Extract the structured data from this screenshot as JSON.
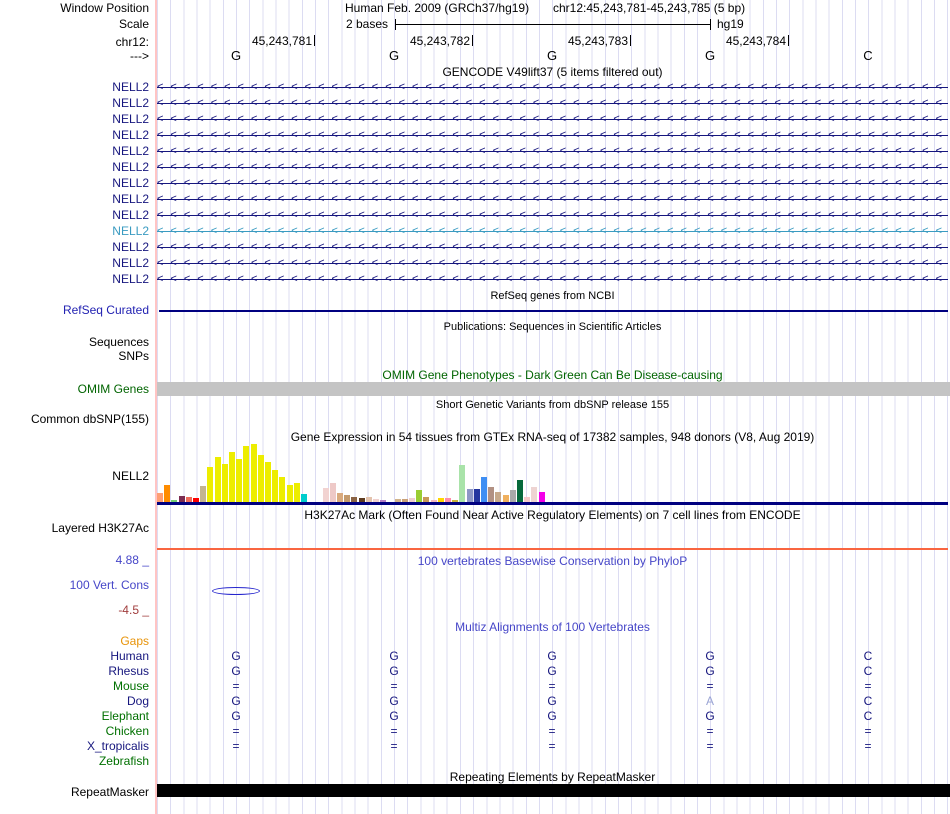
{
  "colors": {
    "navy": "#16167e",
    "teal_highlight": "#3a9bc1",
    "refseq_blue": "#2222b2",
    "omim_green": "#006400",
    "conservation_blue": "#4646c8",
    "conservation_min_red": "#a03c3c",
    "gaps_orange": "#e8940a",
    "species_green": "#007000",
    "muted_base": "#9aa4d4",
    "h3k27ac_line": "#f96540",
    "gtex_baseline": "#000080",
    "omim_bar_gray": "#c4c4c4",
    "repeat_black": "#000000",
    "stripe_lavender": "#dcdcf2",
    "guide_pink": "#ffc4c4"
  },
  "header": {
    "window_position_label": "Window Position",
    "assembly": "Human Feb. 2009 (GRCh37/hg19)",
    "position": "chr12:45,243,781-45,243,785 (5 bp)",
    "scale_label": "Scale",
    "scale_value": "2 bases",
    "genome": "hg19",
    "chrom_label": "chr12:",
    "coords": [
      "45,243,781",
      "45,243,782",
      "45,243,783",
      "45,243,784"
    ],
    "strand_label": "--->",
    "bases": [
      "G",
      "G",
      "G",
      "G",
      "C"
    ]
  },
  "gencode": {
    "title": "GENCODE V49lift37 (5 items filtered out)",
    "genes": [
      {
        "name": "NELL2",
        "highlight": false
      },
      {
        "name": "NELL2",
        "highlight": false
      },
      {
        "name": "NELL2",
        "highlight": false
      },
      {
        "name": "NELL2",
        "highlight": false
      },
      {
        "name": "NELL2",
        "highlight": false
      },
      {
        "name": "NELL2",
        "highlight": false
      },
      {
        "name": "NELL2",
        "highlight": false
      },
      {
        "name": "NELL2",
        "highlight": false
      },
      {
        "name": "NELL2",
        "highlight": false
      },
      {
        "name": "NELL2",
        "highlight": true
      },
      {
        "name": "NELL2",
        "highlight": false
      },
      {
        "name": "NELL2",
        "highlight": false
      },
      {
        "name": "NELL2",
        "highlight": false
      }
    ]
  },
  "refseq": {
    "title": "RefSeq genes from NCBI",
    "label": "RefSeq Curated"
  },
  "publications": {
    "title": "Publications: Sequences in Scientific Articles",
    "row_labels": [
      "Sequences",
      "SNPs"
    ]
  },
  "omim": {
    "title": "OMIM Gene Phenotypes - Dark Green Can Be Disease-causing",
    "label": "OMIM Genes"
  },
  "dbsnp": {
    "title": "Short Genetic Variants from dbSNP release 155",
    "label": "Common dbSNP(155)"
  },
  "gtex": {
    "title": "Gene Expression in 54 tissues from GTEx RNA-seq of 17382 samples, 948 donors (V8, Aug 2019)",
    "label": "NELL2"
  },
  "h3k27ac": {
    "title": "H3K27Ac Mark (Often Found Near Active Regulatory Elements) on 7 cell lines from ENCODE",
    "label": "Layered H3K27Ac"
  },
  "conservation": {
    "title": "100 vertebrates Basewise Conservation by PhyloP",
    "label": "100 Vert. Cons",
    "scale_max": "4.88 _",
    "scale_min": "-4.5 _"
  },
  "multiz": {
    "title": "Multiz Alignments of 100 Vertebrates",
    "rows": [
      {
        "label": "Gaps",
        "color": "#e8940a",
        "cells": [
          "",
          "",
          "",
          "",
          ""
        ]
      },
      {
        "label": "Human",
        "color": "#16167e",
        "cells": [
          "G",
          "G",
          "G",
          "G",
          "C"
        ]
      },
      {
        "label": "Rhesus",
        "color": "#16167e",
        "cells": [
          "G",
          "G",
          "G",
          "G",
          "C"
        ]
      },
      {
        "label": "Mouse",
        "color": "#007000",
        "cells": [
          "=",
          "=",
          "=",
          "=",
          "="
        ]
      },
      {
        "label": "Dog",
        "color": "#16167e",
        "cells": [
          "G",
          "G",
          "G",
          "A",
          "C"
        ],
        "muted_cols": [
          3
        ]
      },
      {
        "label": "Elephant",
        "color": "#007000",
        "cells": [
          "G",
          "G",
          "G",
          "G",
          "C"
        ]
      },
      {
        "label": "Chicken",
        "color": "#007000",
        "cells": [
          "=",
          "=",
          "=",
          "=",
          "="
        ]
      },
      {
        "label": "X_tropicalis",
        "color": "#16167e",
        "cells": [
          "=",
          "=",
          "=",
          "=",
          "="
        ]
      },
      {
        "label": "Zebrafish",
        "color": "#007000",
        "cells": [
          "",
          "",
          "",
          "",
          ""
        ]
      }
    ]
  },
  "repeatmasker": {
    "title": "Repeating Elements by RepeatMasker",
    "label": "RepeatMasker"
  },
  "chart_data": {
    "type": "bar",
    "title": "Gene Expression in 54 tissues from GTEx RNA-seq of 17382 samples, 948 donors (V8, Aug 2019)",
    "gene": "NELL2",
    "ylabel": "",
    "xlabel": "",
    "legend": "none",
    "note": "tissue names are not rendered in the image; values are approximate bar heights in pixels",
    "values": [
      9,
      17,
      2,
      6,
      5,
      4,
      16,
      35,
      45,
      38,
      50,
      43,
      56,
      58,
      47,
      40,
      32,
      25,
      17,
      19,
      8,
      0,
      0,
      14,
      19,
      9,
      7,
      5,
      4,
      5,
      3,
      2,
      0,
      3,
      3,
      4,
      12,
      5,
      2,
      4,
      4,
      2,
      37,
      13,
      13,
      25,
      15,
      10,
      7,
      12,
      22,
      5,
      15,
      10
    ],
    "colors": [
      "#ff9e73",
      "#ff8c00",
      "#74cf74",
      "#7b2d52",
      "#ee6a5a",
      "#fd0000",
      "#c3b490",
      "#eded00",
      "#eded00",
      "#eded00",
      "#eded00",
      "#eded00",
      "#eded00",
      "#eded00",
      "#eded00",
      "#eded00",
      "#eded00",
      "#eded00",
      "#eded00",
      "#eded00",
      "#00cdcd",
      null,
      null,
      "#f2d3d1",
      "#eec9c7",
      "#d9aa7e",
      "#c49a6c",
      "#8a6344",
      "#5e3b20",
      "#e3c3ad",
      "#f0d1cf",
      "#b57fc6",
      null,
      "#d2b48c",
      "#caa179",
      "#efcfcf",
      "#9acd32",
      "#c89858",
      "#f4b8c2",
      "#ffd700",
      "#ff8da8",
      "#c9b33c",
      "#a9e3a9",
      "#8d97c6",
      "#24359f",
      "#3f8ef3",
      "#b29183",
      "#c7a98b",
      "#f0b05e",
      "#a9a9a9",
      "#06693c",
      "#f6caca",
      "#eed4d2",
      "#f400e9"
    ]
  }
}
